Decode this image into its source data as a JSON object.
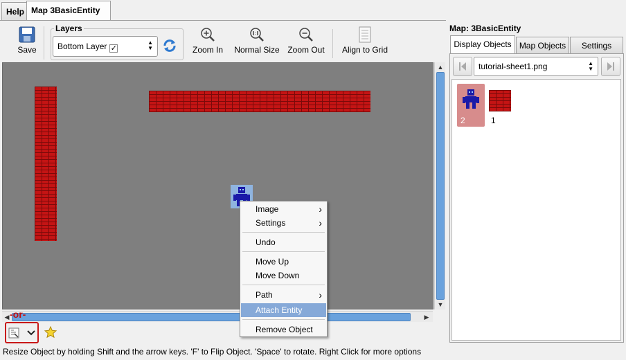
{
  "tabs": [
    {
      "label": "Help"
    },
    {
      "label": "Map 3BasicEntity"
    }
  ],
  "toolbar": {
    "save_label": "Save",
    "layers_title": "Layers",
    "layer_selected": "Bottom Layer",
    "zoom_in_label": "Zoom In",
    "normal_size_label": "Normal Size",
    "zoom_out_label": "Zoom Out",
    "align_grid_label": "Align to Grid"
  },
  "context_menu": {
    "items": [
      {
        "label": "Image",
        "submenu": true
      },
      {
        "label": "Settings",
        "submenu": true
      },
      {
        "label": "Undo",
        "submenu": false
      },
      {
        "label": "Move Up",
        "submenu": false
      },
      {
        "label": "Move Down",
        "submenu": false
      },
      {
        "label": "Path",
        "submenu": true
      },
      {
        "label": "Attach Entity",
        "submenu": false,
        "highlighted": true
      },
      {
        "label": "Remove Object",
        "submenu": false
      }
    ]
  },
  "bottom": {
    "or_label": "-or-"
  },
  "status_bar": {
    "text": "Resize Object by holding Shift and the arrow keys. 'F' to Flip Object. 'Space' to rotate. Right Click for more options"
  },
  "right_panel": {
    "title": "Map: 3BasicEntity",
    "tabs": [
      {
        "label": "Display Objects"
      },
      {
        "label": "Map Objects"
      },
      {
        "label": "Settings"
      }
    ],
    "sheet_selected": "tutorial-sheet1.png",
    "objects": [
      {
        "label": "2",
        "selected": true,
        "kind": "character"
      },
      {
        "label": "1",
        "selected": false,
        "kind": "brick"
      }
    ]
  },
  "colors": {
    "canvas_bg": "#7f7f7f",
    "brick": "#c41414",
    "selection_accent": "#86a9d8",
    "or_highlight": "#c81818",
    "sprite_blue": "#1a1aa8"
  }
}
